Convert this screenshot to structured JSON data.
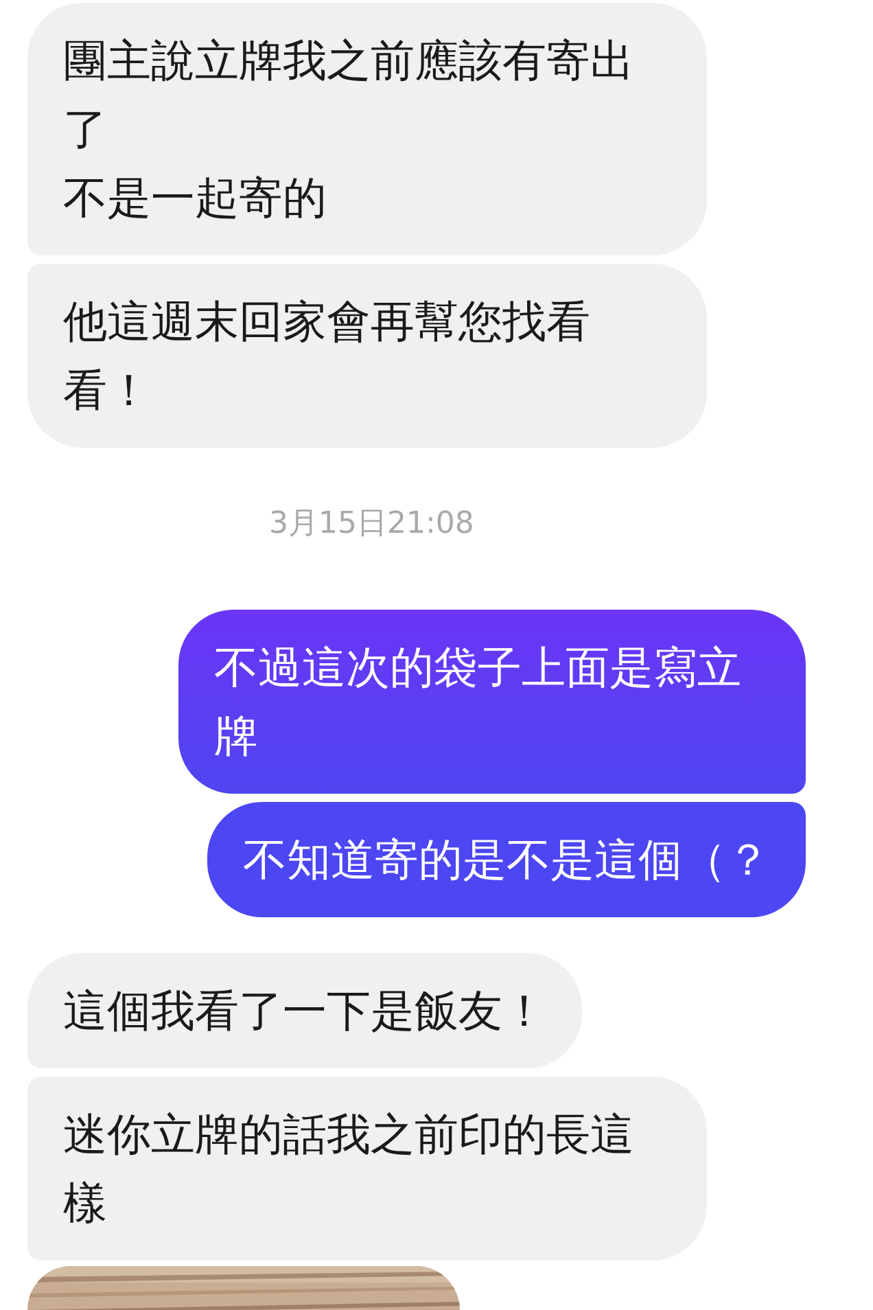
{
  "messages": [
    {
      "kind": "received",
      "lines": [
        "團主說立牌我之前應該有寄出了",
        "不是一起寄的"
      ]
    },
    {
      "kind": "received",
      "lines": [
        "他這週末回家會再幫您找看看！"
      ]
    },
    {
      "kind": "timestamp",
      "text": "3月15日21:08"
    },
    {
      "kind": "sent",
      "lines": [
        "不過這次的袋子上面是寫立牌"
      ]
    },
    {
      "kind": "sent",
      "lines": [
        "不知道寄的是不是這個（？"
      ]
    },
    {
      "kind": "received",
      "lines": [
        "這個我看了一下是飯友！"
      ]
    },
    {
      "kind": "received",
      "lines": [
        "迷你立牌的話我之前印的長這樣"
      ]
    },
    {
      "kind": "picture"
    }
  ]
}
